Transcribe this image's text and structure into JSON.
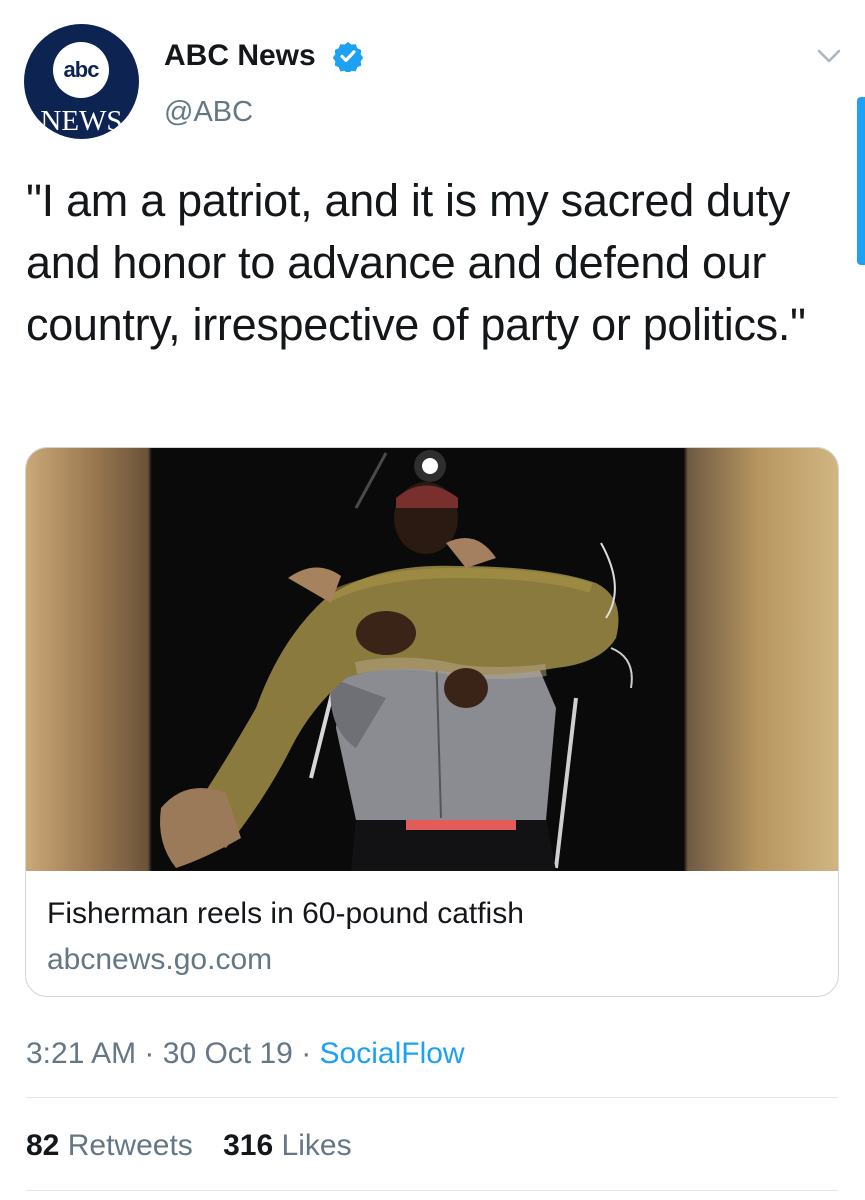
{
  "tweet": {
    "author": {
      "avatar_text_top": "abc",
      "avatar_text_bottom": "NEWS",
      "display_name": "ABC News",
      "handle": "@ABC",
      "verified": true
    },
    "text": "\"I am a patriot, and it is my sacred duty and honor to advance and defend our country, irrespective of party or politics.\"",
    "card": {
      "image_icon": "photo-fisherman-catfish",
      "title": "Fisherman reels in 60-pound catfish",
      "domain": "abcnews.go.com"
    },
    "meta": {
      "time": "3:21 AM",
      "separator": "·",
      "date": "30 Oct 19",
      "source": "SocialFlow"
    },
    "stats": {
      "retweets_count": "82",
      "retweets_label": "Retweets",
      "likes_count": "316",
      "likes_label": "Likes"
    }
  },
  "colors": {
    "link_blue": "#1da1f2",
    "secondary_text": "#657786",
    "abc_navy": "#0d2452"
  }
}
